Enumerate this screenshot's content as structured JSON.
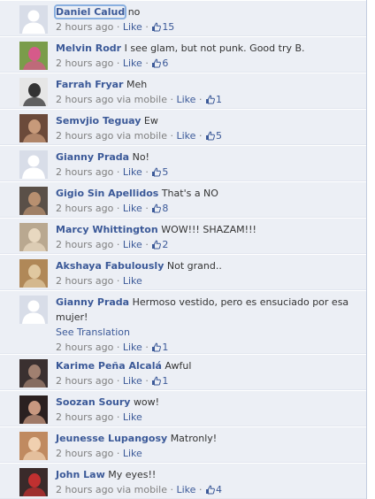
{
  "comments": [
    {
      "author": "Daniel Calud",
      "text": "no",
      "time": "2 hours ago",
      "via": "",
      "like": "Like",
      "likes": "15",
      "translate": "",
      "avatar": {
        "kind": "default",
        "bg": "#d8dde8"
      }
    },
    {
      "author": "Melvin Rodr",
      "text": "I see glam, but not punk. Good try B.",
      "time": "2 hours ago",
      "via": "",
      "like": "Like",
      "likes": "6",
      "translate": "",
      "avatar": {
        "kind": "photo",
        "bg": "#7a9c4a",
        "fg": "#d65a8a"
      }
    },
    {
      "author": "Farrah Fryar",
      "text": "Meh",
      "time": "2 hours ago",
      "via": "via mobile",
      "like": "Like",
      "likes": "1",
      "translate": "",
      "avatar": {
        "kind": "photo",
        "bg": "#e6e6e6",
        "fg": "#333333"
      }
    },
    {
      "author": "Semvjio Teguay",
      "text": "Ew",
      "time": "2 hours ago",
      "via": "via mobile",
      "like": "Like",
      "likes": "5",
      "translate": "",
      "avatar": {
        "kind": "photo",
        "bg": "#6b4a3a",
        "fg": "#c79a7a"
      }
    },
    {
      "author": "Gianny Prada",
      "text": "No!",
      "time": "2 hours ago",
      "via": "",
      "like": "Like",
      "likes": "5",
      "translate": "",
      "avatar": {
        "kind": "default",
        "bg": "#d8dde8"
      }
    },
    {
      "author": "Gigio Sin Apellidos",
      "text": "That's a NO",
      "time": "2 hours ago",
      "via": "",
      "like": "Like",
      "likes": "8",
      "translate": "",
      "avatar": {
        "kind": "photo",
        "bg": "#5a5048",
        "fg": "#b89070"
      }
    },
    {
      "author": "Marcy Whittington",
      "text": "WOW!!! SHAZAM!!!",
      "time": "2 hours ago",
      "via": "",
      "like": "Like",
      "likes": "2",
      "translate": "",
      "avatar": {
        "kind": "photo",
        "bg": "#b9a890",
        "fg": "#e8d8c0"
      }
    },
    {
      "author": "Akshaya Fabulously",
      "text": "Not grand..",
      "time": "2 hours ago",
      "via": "",
      "like": "Like",
      "likes": "",
      "translate": "",
      "avatar": {
        "kind": "photo",
        "bg": "#b08858",
        "fg": "#e0c8a0"
      }
    },
    {
      "author": "Gianny Prada",
      "text": "Hermoso vestido, pero es ensuciado por esa mujer!",
      "time": "2 hours ago",
      "via": "",
      "like": "Like",
      "likes": "1",
      "translate": "See Translation",
      "avatar": {
        "kind": "default",
        "bg": "#d8dde8"
      }
    },
    {
      "author": "Karime Peña Alcalá",
      "text": "Awful",
      "time": "2 hours ago",
      "via": "",
      "like": "Like",
      "likes": "1",
      "translate": "",
      "avatar": {
        "kind": "photo",
        "bg": "#3a3030",
        "fg": "#a08070"
      }
    },
    {
      "author": "Soozan Soury",
      "text": "wow!",
      "time": "2 hours ago",
      "via": "",
      "like": "Like",
      "likes": "",
      "translate": "",
      "avatar": {
        "kind": "photo",
        "bg": "#2a2020",
        "fg": "#c89880"
      }
    },
    {
      "author": "Jeunesse Lupangosy",
      "text": "Matronly!",
      "time": "2 hours ago",
      "via": "",
      "like": "Like",
      "likes": "",
      "translate": "",
      "avatar": {
        "kind": "photo",
        "bg": "#c08a60",
        "fg": "#f0d0b0"
      }
    },
    {
      "author": "John Law",
      "text": "My eyes!!",
      "time": "2 hours ago",
      "via": "via mobile",
      "like": "Like",
      "likes": "4",
      "translate": "",
      "avatar": {
        "kind": "photo",
        "bg": "#3a2a2a",
        "fg": "#c03030"
      }
    }
  ],
  "colors": {
    "link": "#3b5998",
    "meta": "#7f7f7f",
    "feed_bg": "#eceff5"
  },
  "icons": {
    "like_count": "thumbs-up-icon",
    "avatar_default": "default-avatar-icon"
  }
}
